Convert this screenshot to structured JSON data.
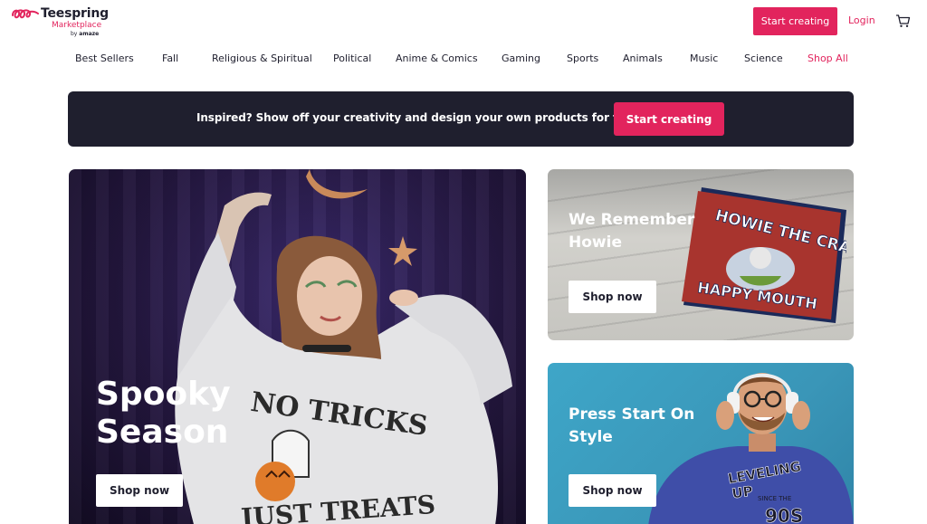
{
  "brand": {
    "name": "Teespring",
    "sub": "Marketplace",
    "by_prefix": "by",
    "by_name": "amaze"
  },
  "header": {
    "start_creating": "Start creating",
    "login": "Login",
    "cart_icon": "cart-icon"
  },
  "categories": [
    "Best Sellers",
    "Fall",
    "Religious & Spiritual",
    "Political",
    "Anime & Comics",
    "Gaming",
    "Sports",
    "Animals",
    "Music",
    "Science",
    "Shop All"
  ],
  "promo": {
    "text": "Inspired? Show off your creativity and design your own products for free!",
    "button": "Start creating"
  },
  "hero": {
    "title": "Spooky Season",
    "button": "Shop now",
    "shirt_text_1": "NO TRICKS",
    "shirt_text_2": "JUST TREATS"
  },
  "cards": [
    {
      "title": "We Remember Howie",
      "button": "Shop now",
      "book_title_1": "HOWIE THE CRABS",
      "book_title_2": "HAPPY MOUTH"
    },
    {
      "title": "Press Start On Style",
      "button": "Shop now",
      "shirt_text_1": "LEVELING",
      "shirt_text_2": "UP",
      "shirt_text_3": "SINCE THE",
      "shirt_text_4": "90S"
    }
  ],
  "colors": {
    "accent": "#e2245d",
    "dark": "#1f1f2e",
    "white": "#ffffff"
  }
}
